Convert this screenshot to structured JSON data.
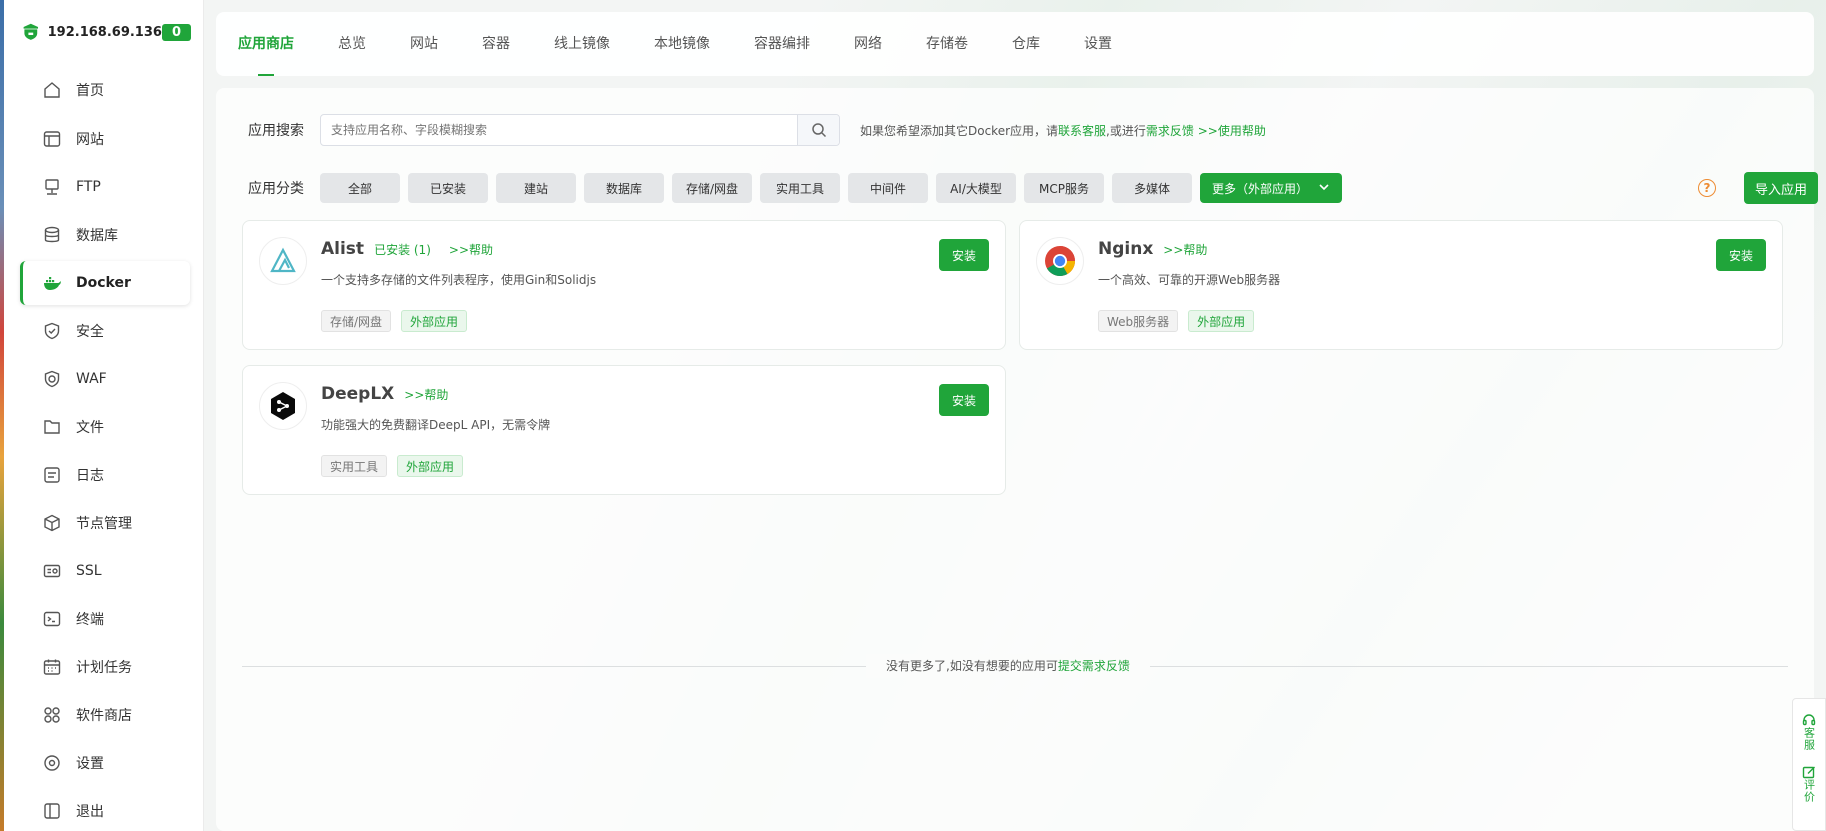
{
  "sidebar": {
    "ip": "192.168.69.136",
    "count": "0",
    "items": [
      {
        "label": "首页",
        "icon": "home-icon"
      },
      {
        "label": "网站",
        "icon": "website-icon"
      },
      {
        "label": "FTP",
        "icon": "ftp-icon"
      },
      {
        "label": "数据库",
        "icon": "database-icon"
      },
      {
        "label": "Docker",
        "icon": "docker-icon"
      },
      {
        "label": "安全",
        "icon": "shield-icon"
      },
      {
        "label": "WAF",
        "icon": "waf-icon"
      },
      {
        "label": "文件",
        "icon": "folder-icon"
      },
      {
        "label": "日志",
        "icon": "log-icon"
      },
      {
        "label": "节点管理",
        "icon": "cube-icon"
      },
      {
        "label": "SSL",
        "icon": "ssl-icon"
      },
      {
        "label": "终端",
        "icon": "terminal-icon"
      },
      {
        "label": "计划任务",
        "icon": "calendar-icon"
      },
      {
        "label": "软件商店",
        "icon": "apps-icon"
      },
      {
        "label": "设置",
        "icon": "gear-icon"
      },
      {
        "label": "退出",
        "icon": "logout-icon"
      }
    ],
    "active": "Docker"
  },
  "tabs": [
    "应用商店",
    "总览",
    "网站",
    "容器",
    "线上镜像",
    "本地镜像",
    "容器编排",
    "网络",
    "存储卷",
    "仓库",
    "设置"
  ],
  "search": {
    "label": "应用搜索",
    "placeholder": "支持应用名称、字段模糊搜索",
    "hint_prefix": "如果您希望添加其它Docker应用，请",
    "hint_link1": "联系客服",
    "hint_mid": ",或进行",
    "hint_link2": "需求反馈",
    "hint_link3": " >>使用帮助"
  },
  "categories": {
    "label": "应用分类",
    "items": [
      "全部",
      "已安装",
      "建站",
      "数据库",
      "存储/网盘",
      "实用工具",
      "中间件",
      "AI/大模型",
      "MCP服务",
      "多媒体"
    ],
    "more": "更多（外部应用）",
    "import": "导入应用"
  },
  "apps": [
    {
      "name": "Alist",
      "installed": "已安装 (1)",
      "help": ">>帮助",
      "desc": "一个支持多存储的文件列表程序，使用Gin和Solidjs",
      "tag1": "存储/网盘",
      "tag2": "外部应用",
      "install": "安装"
    },
    {
      "name": "Nginx",
      "installed": "",
      "help": ">>帮助",
      "desc": "一个高效、可靠的开源Web服务器",
      "tag1": "Web服务器",
      "tag2": "外部应用",
      "install": "安装"
    },
    {
      "name": "DeepLX",
      "installed": "",
      "help": ">>帮助",
      "desc": "功能强大的免费翻译DeepL API，无需令牌",
      "tag1": "实用工具",
      "tag2": "外部应用",
      "install": "安装"
    }
  ],
  "footer": {
    "text": "没有更多了,如没有想要的应用可",
    "link": "提交需求反馈"
  },
  "float_panel": {
    "support": "客服",
    "review": "评价"
  },
  "colors": {
    "accent": "#20a53a",
    "warning": "#ee8c33"
  }
}
